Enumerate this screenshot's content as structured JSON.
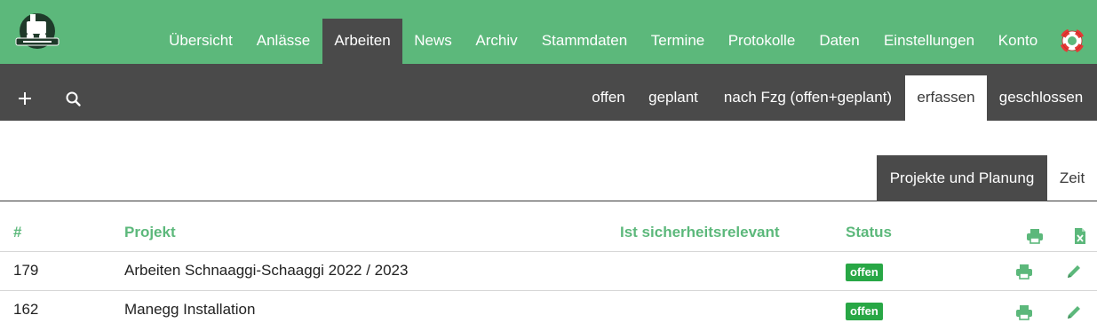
{
  "colors": {
    "brand_green": "#5cb87b",
    "dark_bar": "#4a4a4a",
    "badge_green": "#28a745"
  },
  "topnav": {
    "logo_icon": "railway-club-logo",
    "items": [
      {
        "label": "Übersicht"
      },
      {
        "label": "Anlässe"
      },
      {
        "label": "Arbeiten",
        "active": true
      },
      {
        "label": "News"
      },
      {
        "label": "Archiv"
      },
      {
        "label": "Stammdaten"
      },
      {
        "label": "Termine"
      },
      {
        "label": "Protokolle"
      },
      {
        "label": "Daten"
      },
      {
        "label": "Einstellungen"
      },
      {
        "label": "Konto"
      }
    ],
    "help_icon": "lifebuoy-icon"
  },
  "subnav": {
    "tools": [
      {
        "icon": "plus-icon"
      },
      {
        "icon": "search-icon"
      }
    ],
    "tabs": [
      {
        "label": "offen"
      },
      {
        "label": "geplant"
      },
      {
        "label": "nach Fzg (offen+geplant)"
      },
      {
        "label": "erfassen",
        "active": true
      },
      {
        "label": "geschlossen"
      }
    ]
  },
  "section_tabs": [
    {
      "label": "Projekte und Planung",
      "active": true
    },
    {
      "label": "Zeit"
    }
  ],
  "table": {
    "headers": {
      "id": "#",
      "project": "Projekt",
      "safety": "Ist sicherheitsrelevant",
      "status": "Status"
    },
    "header_icons": {
      "print": "printer-icon",
      "export": "excel-file-icon"
    },
    "rows": [
      {
        "id": "179",
        "project": "Arbeiten Schnaaggi-Schaaggi 2022 / 2023",
        "safety": "",
        "status": "offen"
      },
      {
        "id": "162",
        "project": "Manegg Installation",
        "safety": "",
        "status": "offen"
      }
    ],
    "row_icons": {
      "print": "printer-icon",
      "edit": "pencil-icon"
    }
  }
}
